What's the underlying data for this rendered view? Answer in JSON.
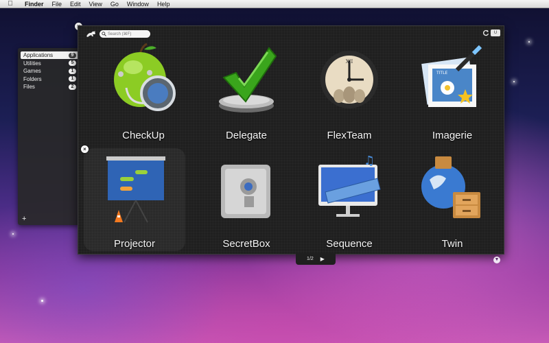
{
  "menubar": {
    "apple": "",
    "items": [
      "Finder",
      "File",
      "Edit",
      "View",
      "Go",
      "Window",
      "Help"
    ]
  },
  "sidebar": {
    "items": [
      {
        "label": "Applications",
        "count": "9",
        "selected": true
      },
      {
        "label": "Utilities",
        "count": "5"
      },
      {
        "label": "Games",
        "count": "1"
      },
      {
        "label": "Folders",
        "count": "1"
      },
      {
        "label": "Files",
        "count": "2"
      }
    ],
    "add": "+"
  },
  "panel": {
    "search_placeholder": "Search (⌘F)",
    "page_button": "U",
    "close": "×"
  },
  "apps": [
    {
      "label": "CheckUp",
      "icon": "apple-stethoscope-icon"
    },
    {
      "label": "Delegate",
      "icon": "green-checkmark-icon"
    },
    {
      "label": "FlexTeam",
      "icon": "clock-team-icon"
    },
    {
      "label": "Imagerie",
      "icon": "photos-wand-icon"
    },
    {
      "label": "Projector",
      "icon": "presentation-screen-icon",
      "selected": true
    },
    {
      "label": "SecretBox",
      "icon": "safe-icon"
    },
    {
      "label": "Sequence",
      "icon": "monitor-filmstrip-icon"
    },
    {
      "label": "Twin",
      "icon": "globe-drawers-icon"
    }
  ],
  "pager": {
    "page": "1/2",
    "next": "▶"
  },
  "colors": {
    "panel_bg": "#1f1f1f",
    "check_green": "#3aa51c",
    "apple_green": "#8ccc24"
  }
}
